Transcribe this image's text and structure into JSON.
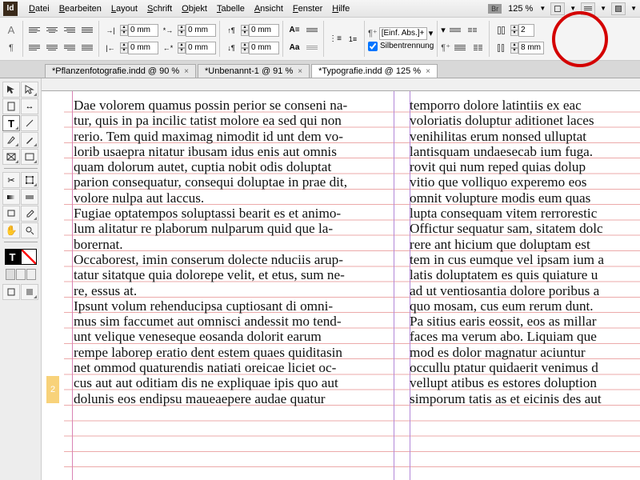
{
  "app": {
    "logo": "Id"
  },
  "menu": {
    "items": [
      "Datei",
      "Bearbeiten",
      "Layout",
      "Schrift",
      "Objekt",
      "Tabelle",
      "Ansicht",
      "Fenster",
      "Hilfe"
    ],
    "br": "Br",
    "zoom": "125 %"
  },
  "control": {
    "mode": "A",
    "indent_left": "0 mm",
    "indent_first": "0 mm",
    "indent_right": "0 mm",
    "indent_last": "0 mm",
    "space_before": "0 mm",
    "space_after": "0 mm",
    "para_style": "[Einf. Abs.]+",
    "hyphenation_label": "Silbentrennung",
    "columns": "2",
    "gutter": "8 mm"
  },
  "tabs": [
    {
      "label": "*Pflanzenfotografie.indd @ 90 %",
      "active": false
    },
    {
      "label": "*Unbenannt-1 @ 91 %",
      "active": false
    },
    {
      "label": "*Typografie.indd @ 125 %",
      "active": true
    }
  ],
  "page_number": "2",
  "text": {
    "col1": "Dae volorem quamus possin perior se conseni na-\ntur, quis in pa incilic tatist molore ea sed qui non\nrerio. Tem quid maximag nimodit id unt dem vo-\nlorib usaepra nitatur ibusam idus enis aut omnis\nquam dolorum autet, cuptia nobit odis doluptat\nparion consequatur, consequi doluptae in prae dit,\nvolore nulpa aut laccus.\nFugiae optatempos soluptassi bearit es et animo-\nlum alitatur re plaborum nulparum quid que la-\nborernat.\nOccaborest, imin conserum dolecte nduciis arup-\ntatur sitatque quia dolorepe velit, et etus, sum ne-\nre, essus at.\nIpsunt volum rehenducipsa cuptiosant di omni-\nmus sim faccumet aut omnisci andessit mo tend-\nunt velique veneseque eosanda dolorit earum\nrempe laborep eratio dent estem quaes quiditasin\nnet ommod quaturendis natiati oreicae liciet oc-\ncus aut aut oditiam dis ne expliquae ipis quo aut\ndolunis eos endipsu maueaepere audae quatur",
    "col2": "temporro dolore latintiis ex eac\nvoloriatis doluptur aditionet laces\nvenihilitas erum nonsed ulluptat\nlantisquam undaesecab ium fuga.\nrovit qui num reped quias dolup\nvitio que volliquo experemo eos\nomnit volupture modis eum quas\nlupta consequam vitem rerrorestic\nOffictur sequatur sam, sitatem dolc\nrere ant hicium que doluptam est\ntem in cus eumque vel ipsam ium a\nlatis doluptatem es quis quiature u\nad ut ventiosantia dolore poribus a\nquo mosam, cus eum rerum dunt.\nPa sitius earis eossit, eos as millar\nfaces ma verum abo. Liquiam que\nmod es dolor magnatur aciuntur\noccullu ptatur quidaerit venimus d\nvellupt atibus es estores doluption\nsimporum tatis as et eicinis des aut"
  }
}
